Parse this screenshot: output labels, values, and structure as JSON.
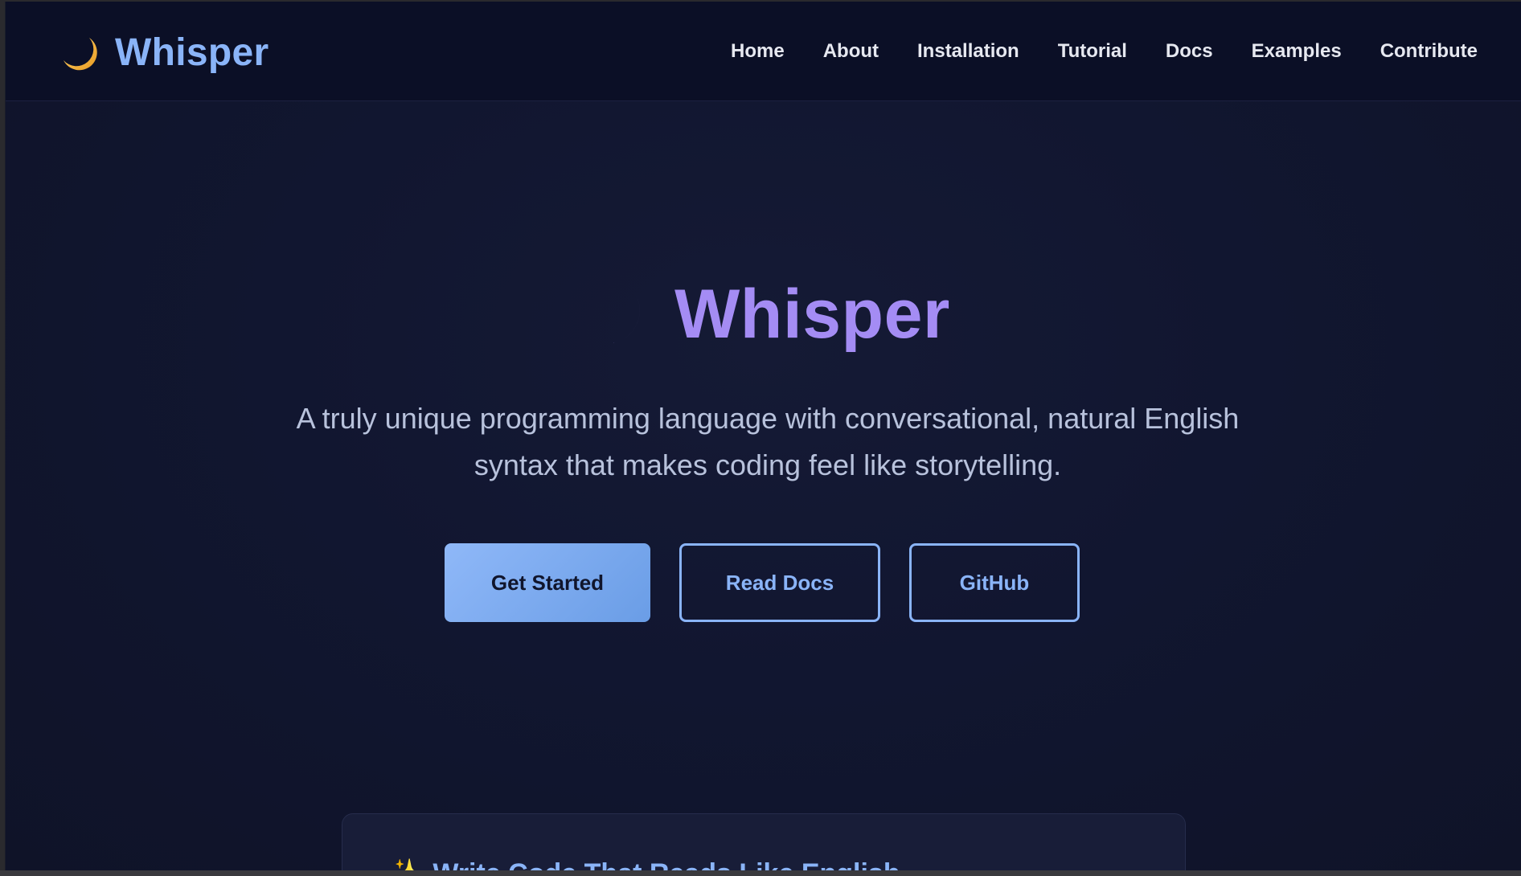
{
  "navbar": {
    "brand": {
      "icon": "crescent-moon-icon",
      "label": "Whisper"
    },
    "links": [
      "Home",
      "About",
      "Installation",
      "Tutorial",
      "Docs",
      "Examples",
      "Contribute"
    ]
  },
  "hero": {
    "icon": "crescent-moon-icon",
    "title": "Whisper",
    "subtitle_line1": "A truly unique programming language with conversational, natural English",
    "subtitle_line2": "syntax that makes coding feel like storytelling."
  },
  "buttons": {
    "get_started": "Get Started",
    "read_docs": "Read Docs",
    "github": "GitHub"
  },
  "card": {
    "icon": "sparkles-icon",
    "title": "Write Code That Reads Like English"
  },
  "colors": {
    "accent": "#8ab4f8",
    "hero_title": "#a48cf4",
    "moon_gold": "#f2b134",
    "background": "#111630",
    "navbar": "#0b0f26"
  }
}
